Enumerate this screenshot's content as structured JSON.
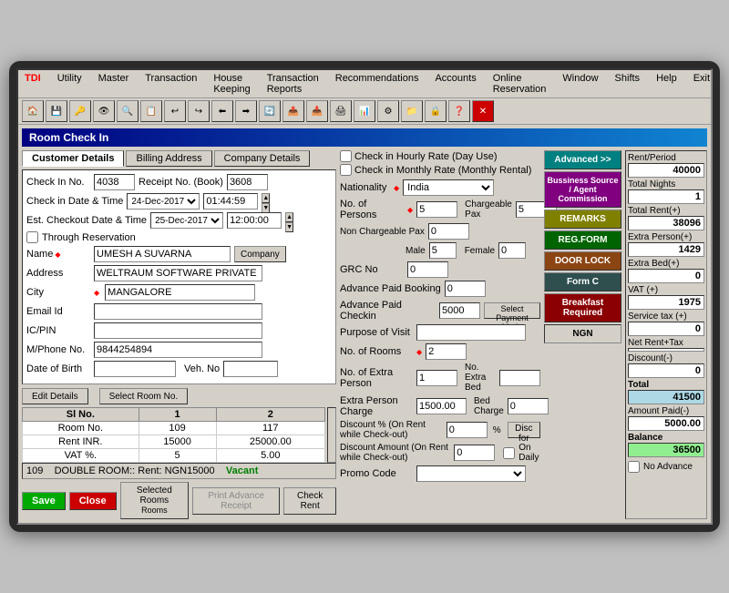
{
  "menubar": {
    "items": [
      "TDI",
      "Utility",
      "Master",
      "Transaction",
      "House Keeping",
      "Transaction Reports",
      "Recommendations",
      "Accounts",
      "Online Reservation",
      "Window",
      "Shifts",
      "Help",
      "Exit"
    ]
  },
  "window": {
    "title": "Room Check In"
  },
  "tabs": {
    "items": [
      "Customer Details",
      "Billing Address",
      "Company Details"
    ]
  },
  "checkin_options": {
    "hourly": "Check in Hourly Rate (Day Use)",
    "monthly": "Check in Monthly Rate (Monthly Rental)"
  },
  "customer": {
    "checkin_no_label": "Check In No.",
    "checkin_no": "4038",
    "receipt_label": "Receipt No. (Book)",
    "receipt_no": "3608",
    "checkin_date_label": "Check in Date & Time",
    "checkin_date": "24-Dec-2017",
    "checkin_time": "01:44:59",
    "checkout_date_label": "Est. Checkout Date & Time",
    "checkout_date": "25-Dec-2017",
    "checkout_time": "12:00:00",
    "through_reservation": "Through Reservation",
    "name_label": "Name",
    "name_value": "UMESH A SUVARNA",
    "company_btn": "Company",
    "address_label": "Address",
    "address_value": "WELTRAUM SOFTWARE PRIVATE LIMITED",
    "city_label": "City",
    "city_value": "MANGALORE",
    "email_label": "Email Id",
    "email_value": "",
    "ic_label": "IC/PIN",
    "ic_value": "",
    "mobile_label": "M/Phone No.",
    "mobile_value": "9844254894",
    "dob_label": "Date of Birth",
    "dob_value": "",
    "veh_label": "Veh. No",
    "veh_value": "",
    "edit_btn": "Edit Details",
    "select_room_btn": "Select Room No."
  },
  "nationality": {
    "label": "Nationality",
    "value": "India"
  },
  "form_fields": {
    "no_persons_label": "No. of Persons",
    "no_persons": "5",
    "chargeable_pax_label": "Chargeable Pax",
    "chargeable_pax": "5",
    "non_chargeable_pax_label": "Non Chargeable Pax",
    "non_chargeable_pax": "0",
    "male_label": "Male",
    "male": "5",
    "female_label": "Female",
    "female": "0",
    "grc_no_label": "GRC No",
    "grc_no": "0",
    "advance_paid_booking_label": "Advance Paid Booking",
    "advance_paid_booking": "0",
    "advance_paid_checkin_label": "Advance Paid Checkin",
    "advance_paid_checkin": "5000",
    "select_payment_mode_btn": "Select Payment Mode",
    "purpose_of_visit_label": "Purpose of Visit",
    "purpose_of_visit": "",
    "no_of_rooms_label": "No. of Rooms",
    "no_of_rooms": "2",
    "no_extra_person_label": "No. of Extra Person",
    "no_extra_person": "1",
    "no_extra_bed_label": "No. Extra Bed",
    "no_extra_bed": "",
    "extra_person_charge_label": "Extra Person Charge",
    "extra_person_charge": "1500.00",
    "bed_charge_label": "Bed Charge",
    "bed_charge": "0",
    "discount_rent_label": "Discount % (On Rent while Check-out)",
    "discount_rent": "0",
    "disc_for_btn": "Disc for",
    "discount_amount_label": "Discount Amount (On Rent while Check-out)",
    "discount_amount": "0",
    "on_daily": "On Daily",
    "promo_code_label": "Promo Code",
    "promo_code": ""
  },
  "status_bar": {
    "room_no": "109",
    "room_type": "DOUBLE ROOM",
    "rent_info": "Rent: NGN15000",
    "status": "Vacant"
  },
  "room_table": {
    "headers": [
      "Sl No.",
      "1",
      "2"
    ],
    "rows": [
      {
        "label": "Room No.",
        "col1": "109",
        "col2": "117"
      },
      {
        "label": "Rent INR.",
        "col1": "15000",
        "col2": "25000.00"
      },
      {
        "label": "VAT %.",
        "col1": "5",
        "col2": "5.00"
      }
    ]
  },
  "selected_rooms": {
    "label": "Selected Rooms"
  },
  "action_buttons": {
    "save": "Save",
    "close": "Close",
    "remove": "Remove Selected Rooms",
    "print": "Print Advance Receipt",
    "check_rent": "Check Rent"
  },
  "side_buttons": {
    "advanced": "Advanced >>",
    "business": "Bussiness Source / Agent Commission",
    "remarks": "REMARKS",
    "reg_form": "REG.FORM",
    "door_lock": "DOOR LOCK",
    "form_c": "Form C",
    "breakfast": "Breakfast Required",
    "ngn": "NGN"
  },
  "summary": {
    "rent_period_label": "Rent/Period",
    "rent_period": "40000",
    "total_nights_label": "Total Nights",
    "total_nights": "1",
    "total_rent_label": "Total Rent(+)",
    "total_rent": "38096",
    "extra_person_label": "Extra Person(+)",
    "extra_person": "1429",
    "extra_bed_label": "Extra Bed(+)",
    "extra_bed": "0",
    "vat_label": "VAT (+)",
    "vat": "1975",
    "service_tax_label": "Service tax (+)",
    "service_tax": "0",
    "net_rent_label": "Net Rent+Tax",
    "net_rent": "",
    "discount_label": "Discount(-)",
    "discount": "0",
    "total_label": "Total",
    "total": "41500",
    "amount_paid_label": "Amount Paid(-)",
    "amount_paid": "5000.00",
    "balance_label": "Balance",
    "balance": "36500",
    "no_advance": "No Advance"
  }
}
